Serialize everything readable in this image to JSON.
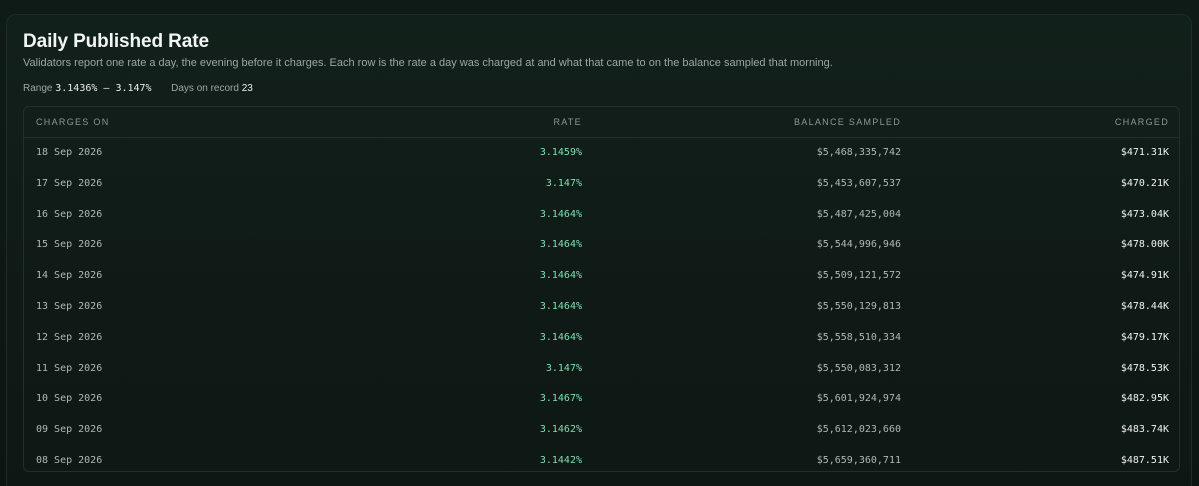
{
  "header": {
    "title": "Daily Published Rate",
    "subtitle": "Validators report one rate a day, the evening before it charges. Each row is the rate a day was charged at and what that came to on the balance sampled that morning."
  },
  "meta": {
    "range_label": "Range",
    "range_value": "3.1436% – 3.147%",
    "days_label": "Days on record",
    "days_value": "23"
  },
  "table": {
    "columns": {
      "charges_on": "CHARGES ON",
      "rate": "RATE",
      "balance": "BALANCE SAMPLED",
      "charged": "CHARGED"
    },
    "rows": [
      {
        "date": "18 Sep 2026",
        "rate": "3.1459%",
        "balance": "$5,468,335,742",
        "charged": "$471.31K"
      },
      {
        "date": "17 Sep 2026",
        "rate": "3.147%",
        "balance": "$5,453,607,537",
        "charged": "$470.21K"
      },
      {
        "date": "16 Sep 2026",
        "rate": "3.1464%",
        "balance": "$5,487,425,004",
        "charged": "$473.04K"
      },
      {
        "date": "15 Sep 2026",
        "rate": "3.1464%",
        "balance": "$5,544,996,946",
        "charged": "$478.00K"
      },
      {
        "date": "14 Sep 2026",
        "rate": "3.1464%",
        "balance": "$5,509,121,572",
        "charged": "$474.91K"
      },
      {
        "date": "13 Sep 2026",
        "rate": "3.1464%",
        "balance": "$5,550,129,813",
        "charged": "$478.44K"
      },
      {
        "date": "12 Sep 2026",
        "rate": "3.1464%",
        "balance": "$5,558,510,334",
        "charged": "$479.17K"
      },
      {
        "date": "11 Sep 2026",
        "rate": "3.147%",
        "balance": "$5,550,083,312",
        "charged": "$478.53K"
      },
      {
        "date": "10 Sep 2026",
        "rate": "3.1467%",
        "balance": "$5,601,924,974",
        "charged": "$482.95K"
      },
      {
        "date": "09 Sep 2026",
        "rate": "3.1462%",
        "balance": "$5,612,023,660",
        "charged": "$483.74K"
      },
      {
        "date": "08 Sep 2026",
        "rate": "3.1442%",
        "balance": "$5,659,360,711",
        "charged": "$487.51K"
      }
    ]
  }
}
